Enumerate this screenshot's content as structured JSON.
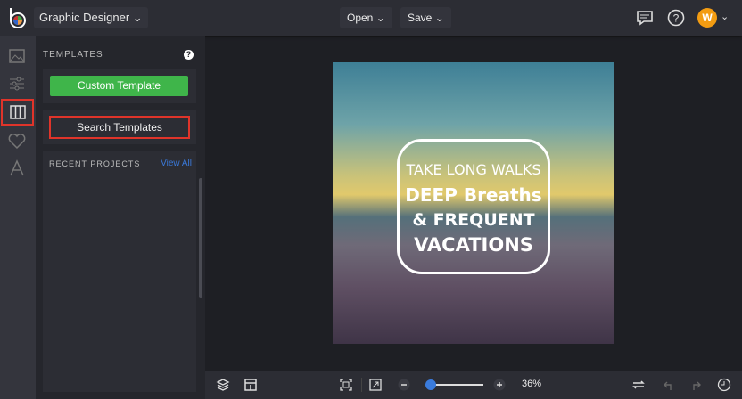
{
  "header": {
    "project_name": "Graphic Designer",
    "open_label": "Open",
    "save_label": "Save",
    "avatar_initial": "W"
  },
  "panel": {
    "title": "TEMPLATES",
    "help": "?",
    "custom_template": "Custom Template",
    "search_templates": "Search Templates",
    "recent_projects": "RECENT PROJECTS",
    "view_all": "View All"
  },
  "canvas": {
    "quote": [
      "TAKE LONG WALKS",
      "DEEP Breaths",
      "& FREQUENT",
      "VACATIONS"
    ]
  },
  "bottom": {
    "zoom_value": "36%",
    "zoom_fraction": 0.05
  },
  "colors": {
    "accent_green": "#3fb54a",
    "highlight_red": "#e0342a",
    "link_blue": "#3a78d8",
    "avatar": "#f39c12"
  }
}
